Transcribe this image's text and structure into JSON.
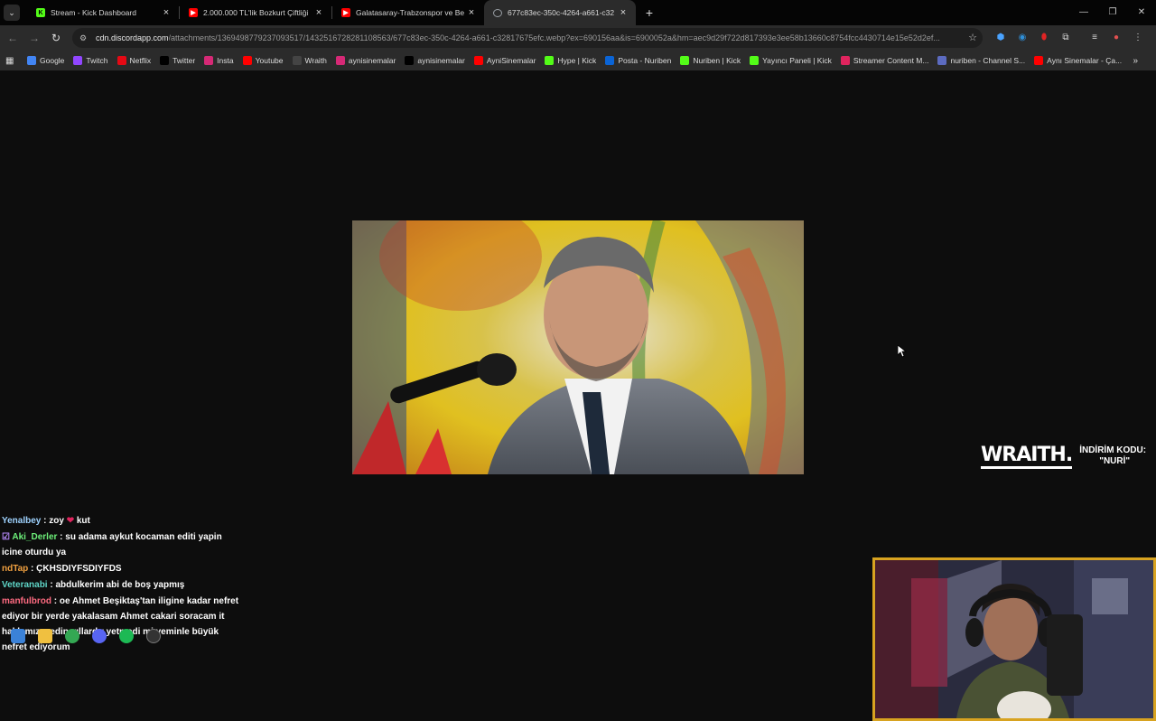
{
  "tabs": [
    {
      "title": "Stream - Kick Dashboard",
      "favicon": "kick-icon",
      "color": "#53fc18"
    },
    {
      "title": "2.000.000 TL'lik Bozkurt Çiftliği",
      "favicon": "youtube-icon",
      "color": "#ff0000"
    },
    {
      "title": "Galatasaray-Trabzonspor ve Be",
      "favicon": "youtube-icon",
      "color": "#ff0000"
    },
    {
      "title": "677c83ec-350c-4264-a661-c32",
      "favicon": "globe-icon",
      "color": "#9aa0a6"
    }
  ],
  "address": {
    "host": "cdn.discordapp.com",
    "path": "/attachments/1369498779237093517/1432516728281108563/677c83ec-350c-4264-a661-c32817675efc.webp?ex=690156aa&is=6900052a&hm=aec9d29f722d817393e3ee58b13660c8754fcc4430714e15e52d2ef..."
  },
  "bookmarks": [
    {
      "label": "Google",
      "icon": "google-icon",
      "color": "#4285f4"
    },
    {
      "label": "Twitch",
      "icon": "twitch-icon",
      "color": "#9146ff"
    },
    {
      "label": "Netflix",
      "icon": "netflix-icon",
      "color": "#e50914"
    },
    {
      "label": "Twitter",
      "icon": "x-icon",
      "color": "#000000"
    },
    {
      "label": "Insta",
      "icon": "instagram-icon",
      "color": "#d62976"
    },
    {
      "label": "Youtube",
      "icon": "youtube-icon",
      "color": "#ff0000"
    },
    {
      "label": "Wraith",
      "icon": "wraith-icon",
      "color": "#444444"
    },
    {
      "label": "aynisinemalar",
      "icon": "instagram-icon",
      "color": "#d62976"
    },
    {
      "label": "aynisinemalar",
      "icon": "x-icon",
      "color": "#000000"
    },
    {
      "label": "AyniSinemalar",
      "icon": "youtube-icon",
      "color": "#ff0000"
    },
    {
      "label": "Hype | Kick",
      "icon": "kick-icon",
      "color": "#53fc18"
    },
    {
      "label": "Posta - Nuriben",
      "icon": "outlook-icon",
      "color": "#0a64d6"
    },
    {
      "label": "Nuriben | Kick",
      "icon": "kick-icon",
      "color": "#53fc18"
    },
    {
      "label": "Yayıncı Paneli | Kick",
      "icon": "kick-icon",
      "color": "#53fc18"
    },
    {
      "label": "Streamer Content M...",
      "icon": "star-burst-icon",
      "color": "#e0245e"
    },
    {
      "label": "nuriben - Channel S...",
      "icon": "channel-icon",
      "color": "#5c6bc0"
    },
    {
      "label": "Aynı Sinemalar - Ça...",
      "icon": "youtube-icon",
      "color": "#ff0000"
    }
  ],
  "overlay": {
    "brand": "WRAITH.",
    "discount_label": "İNDİRİM KODU:",
    "discount_code": "\"NURİ\""
  },
  "chat": [
    {
      "user": "Yenalbey",
      "color": "#9fd3ff",
      "text": " : zoy ",
      "extra": "kut",
      "heart": true,
      "badge": false
    },
    {
      "user": "Aki_Derler",
      "color": "#6df07a",
      "text": " : su adama aykut kocaman editi yapin icine oturdu ya",
      "badge": true
    },
    {
      "user": "ndTap",
      "color": "#f0a040",
      "text": " : ÇKHSDIYFSDIYFDS",
      "badge": false
    },
    {
      "user": "Veteranabi",
      "color": "#5fd6c8",
      "text": " : abdulkerim abi de boş yapmış",
      "badge": false
    },
    {
      "user": "manfulbrod",
      "color": "#ff6b81",
      "text": " : oe Ahmet Beşiktaş'tan iligine kadar nefret ediyor bir yerde yakalasam Ahmet cakari soracam it hakkımızı yedin yıllardır yetmedi mi yeminle büyük nefret ediyorum",
      "badge": false
    }
  ]
}
